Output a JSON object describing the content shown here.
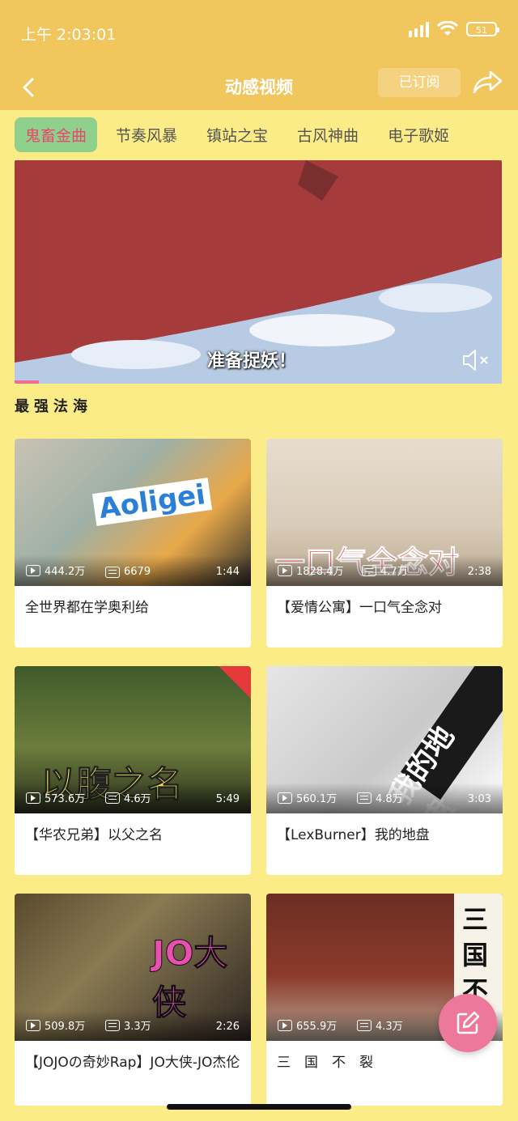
{
  "status": {
    "time": "上午 2:03:01",
    "battery": "51"
  },
  "nav": {
    "title": "动感视频",
    "subscribe_label": "已订阅"
  },
  "tabs": [
    {
      "label": "鬼畜金曲",
      "active": true
    },
    {
      "label": "节奏风暴"
    },
    {
      "label": "镇站之宝"
    },
    {
      "label": "古风神曲"
    },
    {
      "label": "电子歌姬"
    }
  ],
  "hero": {
    "subtitle": "准备捉妖！",
    "caption": "最强法海",
    "progress": 0.05
  },
  "cards": [
    {
      "title": "全世界都在学奥利给",
      "views": "444.2万",
      "danmaku": "6679",
      "duration": "1:44",
      "art": "Aoligei"
    },
    {
      "title": "【爱情公寓】一口气全念对",
      "views": "1828.4万",
      "danmaku": "4.7万",
      "duration": "2:38",
      "art": "一口气全念对"
    },
    {
      "title": "【华农兄弟】以父之名",
      "views": "573.6万",
      "danmaku": "4.6万",
      "duration": "5:49",
      "art": "以腹之名"
    },
    {
      "title": "【LexBurner】我的地盘",
      "views": "560.1万",
      "danmaku": "4.8万",
      "duration": "3:03",
      "art": "我的地盘"
    },
    {
      "title": "【JOJOの奇妙Rap】JO大侠-JO杰伦",
      "views": "509.8万",
      "danmaku": "3.3万",
      "duration": "2:26",
      "art": "JO大侠"
    },
    {
      "title": "三　国　不　裂",
      "views": "655.9万",
      "danmaku": "4.3万",
      "duration": "",
      "art": "三国不"
    }
  ],
  "colors": {
    "header": "#f1c65d",
    "background": "#fcec88",
    "active_tab": "#8fd18c",
    "active_tab_text": "#e8476a",
    "fab": "#ee789c"
  }
}
